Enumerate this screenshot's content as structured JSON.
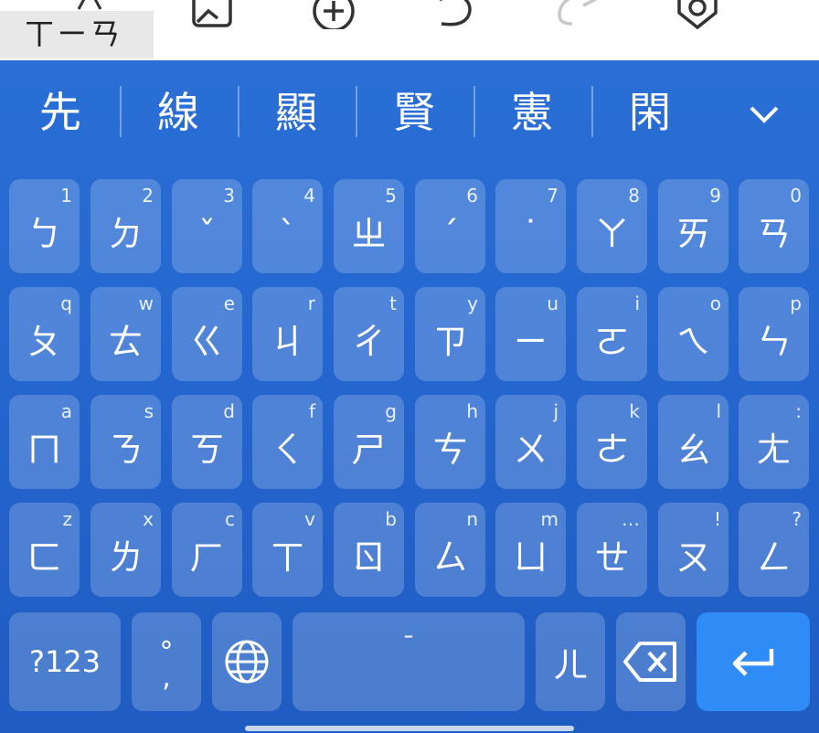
{
  "toolbar": {
    "composing_text": "ㄒㄧㄢ",
    "icons": [
      "text-format-icon",
      "image-icon",
      "add-circle-icon",
      "undo-icon",
      "redo-icon",
      "settings-icon"
    ]
  },
  "candidates": [
    "先",
    "線",
    "顯",
    "賢",
    "憲",
    "閑"
  ],
  "keyboard": {
    "rows": [
      [
        {
          "label": "ㄅ",
          "hint": "1"
        },
        {
          "label": "ㄉ",
          "hint": "2"
        },
        {
          "label": "ˇ",
          "hint": "3"
        },
        {
          "label": "ˋ",
          "hint": "4"
        },
        {
          "label": "ㄓ",
          "hint": "5"
        },
        {
          "label": "ˊ",
          "hint": "6"
        },
        {
          "label": "˙",
          "hint": "7"
        },
        {
          "label": "ㄚ",
          "hint": "8"
        },
        {
          "label": "ㄞ",
          "hint": "9"
        },
        {
          "label": "ㄢ",
          "hint": "0"
        }
      ],
      [
        {
          "label": "ㄆ",
          "hint": "q"
        },
        {
          "label": "ㄊ",
          "hint": "w"
        },
        {
          "label": "ㄍ",
          "hint": "e"
        },
        {
          "label": "ㄐ",
          "hint": "r"
        },
        {
          "label": "ㄔ",
          "hint": "t"
        },
        {
          "label": "ㄗ",
          "hint": "y"
        },
        {
          "label": "ㄧ",
          "hint": "u"
        },
        {
          "label": "ㄛ",
          "hint": "i"
        },
        {
          "label": "ㄟ",
          "hint": "o"
        },
        {
          "label": "ㄣ",
          "hint": "p"
        }
      ],
      [
        {
          "label": "ㄇ",
          "hint": "a"
        },
        {
          "label": "ㄋ",
          "hint": "s"
        },
        {
          "label": "ㄎ",
          "hint": "d"
        },
        {
          "label": "ㄑ",
          "hint": "f"
        },
        {
          "label": "ㄕ",
          "hint": "g"
        },
        {
          "label": "ㄘ",
          "hint": "h"
        },
        {
          "label": "ㄨ",
          "hint": "j"
        },
        {
          "label": "ㄜ",
          "hint": "k"
        },
        {
          "label": "ㄠ",
          "hint": "l"
        },
        {
          "label": "ㄤ",
          "hint": ":"
        }
      ],
      [
        {
          "label": "ㄈ",
          "hint": "z"
        },
        {
          "label": "ㄌ",
          "hint": "x"
        },
        {
          "label": "ㄏ",
          "hint": "c"
        },
        {
          "label": "ㄒ",
          "hint": "v"
        },
        {
          "label": "ㄖ",
          "hint": "b"
        },
        {
          "label": "ㄙ",
          "hint": "n"
        },
        {
          "label": "ㄩ",
          "hint": "m"
        },
        {
          "label": "ㄝ",
          "hint": "…"
        },
        {
          "label": "ㄡ",
          "hint": "!"
        },
        {
          "label": "ㄥ",
          "hint": "?"
        }
      ]
    ],
    "bottom": {
      "symbols_label": "?123",
      "punct_top": "°",
      "punct_bottom": ",",
      "space_label": "ˉ",
      "er_label": "ㄦ"
    }
  },
  "colors": {
    "keyboard_bg": "#2466cf",
    "key_bg": "rgba(255,255,255,0.20)",
    "enter_bg": "#2f8bf5",
    "text": "#ffffff"
  }
}
